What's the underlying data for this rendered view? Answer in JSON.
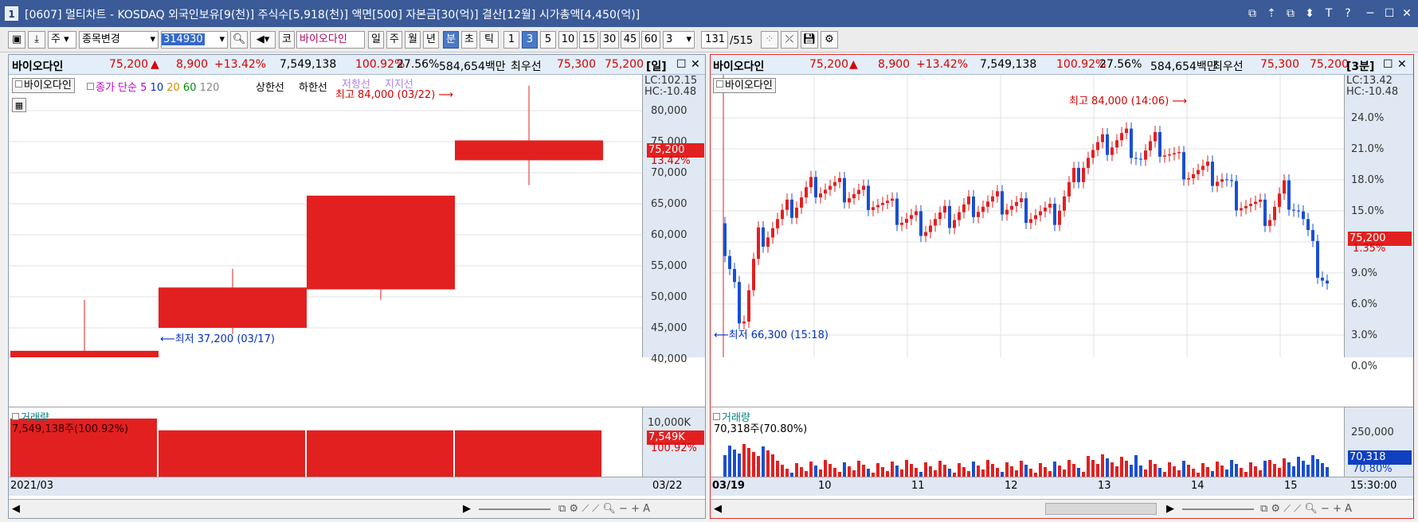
{
  "window": {
    "num": "1",
    "title": "[0607] 멀티차트 - KOSDAQ 외국인보유[9(천)] 주식수[5,918(천)] 액면[500] 자본금[30(억)] 결산[12월] 시가총액[4,450(억)]",
    "controls": [
      "⧉",
      "⇡",
      "⧉",
      "⬍",
      "T",
      "?",
      "─",
      "☐",
      "✕"
    ]
  },
  "toolbar": {
    "market": "주",
    "stock_change": "종목변경",
    "code": "314930",
    "kosdaq_btn": "코",
    "stock_name": "바이오다인",
    "periods": [
      "일",
      "주",
      "월",
      "년",
      "분",
      "초",
      "틱"
    ],
    "selected_period": "분",
    "minutes": [
      "1",
      "3",
      "5",
      "10",
      "15",
      "30",
      "45",
      "60"
    ],
    "selected_minute": "3",
    "count_value": "3",
    "page_value": "131",
    "page_total": "/515"
  },
  "left": {
    "info": {
      "name": "바이오다인",
      "price": "75,200",
      "arrow": "▲",
      "change": "8,900",
      "change_pct": "+13.42%",
      "volume": "7,549,138",
      "vol_ratio": "100.92%",
      "turnover": "27.56%",
      "market_value": "584,654백만",
      "best_label": "최우선",
      "best_ask": "75,300",
      "best_bid": "75,200",
      "period": "[일]"
    },
    "legend": {
      "stock": "바이오다인",
      "ma_label": "종가 단순",
      "ma": [
        "5",
        "10",
        "20",
        "60",
        "120"
      ],
      "limit_up": "상한선",
      "limit_down": "하한선",
      "resistance": "저항선",
      "support": "지지선"
    },
    "hi_lo": {
      "lc": "LC:102.15",
      "hc": "HC:-10.48"
    },
    "high_note": "최고 84,000 (03/22)",
    "low_note": "최저 37,200 (03/17)",
    "price_ticks": [
      "80,000",
      "75,000",
      "70,000",
      "65,000",
      "60,000",
      "55,000",
      "50,000",
      "45,000",
      "40,000"
    ],
    "price_tag": "75,200",
    "pct_tag": "13.42%",
    "volume": {
      "label": "거래량",
      "value": "7,549,138주(100.92%)",
      "tick": "10,000K",
      "tag": "7,549K",
      "pct": "100.92%"
    },
    "x_start": "2021/03",
    "x_end": "03/22",
    "candles": [
      {
        "o": 38800,
        "h": 49500,
        "l": 36500,
        "c": 41300
      },
      {
        "o": 45000,
        "h": 54500,
        "l": 44000,
        "c": 51500
      },
      {
        "o": 51200,
        "h": 66300,
        "l": 49500,
        "c": 66300
      },
      {
        "o": 72000,
        "h": 84000,
        "l": 68000,
        "c": 75200
      }
    ],
    "volumes": [
      100,
      80,
      80,
      80
    ]
  },
  "right": {
    "info": {
      "name": "바이오다인",
      "price": "75,200",
      "arrow": "▲",
      "change": "8,900",
      "change_pct": "+13.42%",
      "volume": "7,549,138",
      "vol_ratio": "100.92%",
      "turnover": "27.56%",
      "market_value": "584,654백만",
      "best_label": "최우선",
      "best_ask": "75,300",
      "best_bid": "75,200",
      "period": "[3분]"
    },
    "legend": {
      "stock": "바이오다인"
    },
    "hi_lo": {
      "lc": "LC:13.42",
      "hc": "HC:-10.48"
    },
    "high_note": "최고 84,000 (14:06)",
    "low_note": "최저 66,300 (15:18)",
    "pct_ticks": [
      "24.0%",
      "21.0%",
      "18.0%",
      "15.0%",
      "12.0%",
      "9.0%",
      "6.0%",
      "3.0%",
      "0.0%"
    ],
    "price_tag": "75,200",
    "pct_tag": "1.35%",
    "volume": {
      "label": "거래량",
      "value": "70,318주(70.80%)",
      "tick": "250,000",
      "tag": "70,318",
      "pct": "70.80%"
    },
    "x_labels": [
      "03/19",
      "10",
      "11",
      "12",
      "13",
      "14",
      "15"
    ],
    "x_end": "15:30:00"
  },
  "colors": {
    "up": "#e22020",
    "down": "#1a4fd0",
    "accent": "#3a5a98"
  }
}
